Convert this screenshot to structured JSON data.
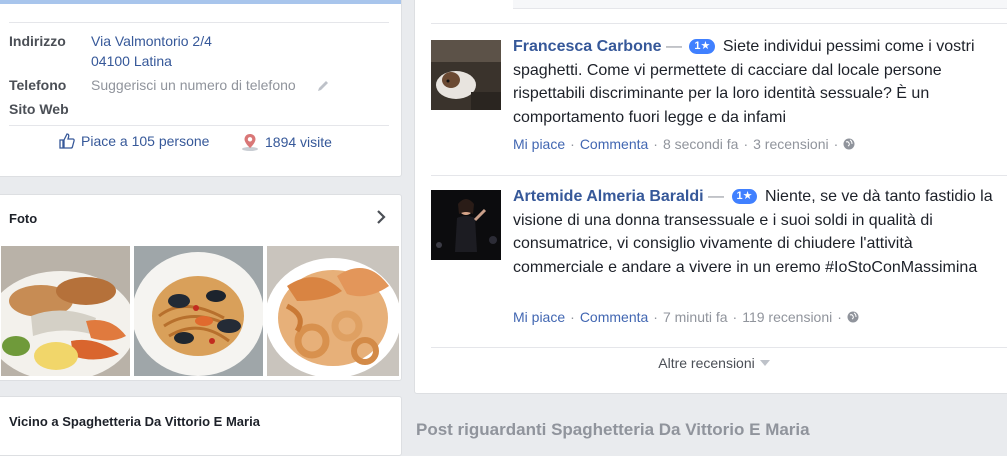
{
  "info": {
    "address_label": "Indirizzo",
    "address_line1": "Via Valmontorio 2/4",
    "address_line2": "04100 Latina",
    "phone_label": "Telefono",
    "phone_suggest": "Suggerisci un numero di telefono",
    "website_label": "Sito Web",
    "likes_text": "Piace a 105 persone",
    "visits_text": "1894 visite"
  },
  "photos": {
    "title": "Foto"
  },
  "nearby": {
    "title": "Vicino a Spaghetteria Da Vittorio E Maria"
  },
  "reviews": [
    {
      "author": "Francesca Carbone",
      "dash": "—",
      "rating": "1★",
      "text": "Siete individui pessimi come i vostri spaghetti. Come vi permettete di cacciare dal locale persone rispettabili discriminante per la loro identità sessuale? È un comportamento fuori legge e da infami",
      "like_label": "Mi piace",
      "comment_label": "Commenta",
      "time": "8 secondi fa",
      "review_count": "3 recensioni"
    },
    {
      "author": "Artemide Almeria Baraldi",
      "dash": "—",
      "rating": "1★",
      "text": "Niente, se ve dà tanto fastidio la visione di una donna transessuale e i suoi soldi in qualità di consumatrice, vi consiglio vivamente di chiudere l'attività commerciale e andare a vivere in un eremo #IoStoConMassimina",
      "like_label": "Mi piace",
      "comment_label": "Commenta",
      "time": "7 minuti fa",
      "review_count": "119 recensioni"
    }
  ],
  "more_reviews_label": "Altre recensioni",
  "posts_heading": "Post riguardanti Spaghetteria Da Vittorio E Maria",
  "colors": {
    "link": "#365899",
    "accent": "#4080ff",
    "page_bg": "#e9ebee",
    "muted": "#90949c"
  }
}
